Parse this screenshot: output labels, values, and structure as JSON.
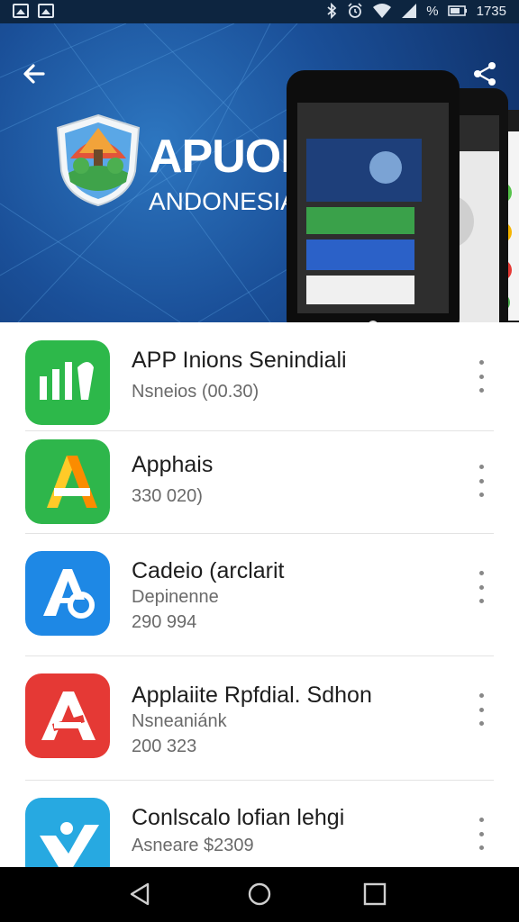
{
  "status_bar": {
    "left_icons": [
      "image-icon",
      "image-icon"
    ],
    "right_icons": [
      "bluetooth-icon",
      "alarm-icon",
      "wifi-icon",
      "signal-icon",
      "battery-icon"
    ],
    "battery_text": "%",
    "time": "1735"
  },
  "hero": {
    "back_icon": "arrow-left-icon",
    "share_icon": "share-icon",
    "brand_title": "APUOR",
    "brand_subtitle": "ANDONESIA",
    "accent": "#1a4f98"
  },
  "list": {
    "items": [
      {
        "title": "APP Inions Senindiali",
        "line1": "Nsneios (00.30)",
        "line2": "",
        "icon": "chart-app-icon",
        "color": "#2db84a"
      },
      {
        "title": "Apphais",
        "line1": "330 020)",
        "line2": "",
        "icon": "letter-a-app-icon",
        "color": "#2eb64b"
      },
      {
        "title": "Cadeio (arclarit",
        "line1": "Depinenne",
        "line2": "290 994",
        "icon": "letter-a-blue-app-icon",
        "color": "#1e88e5"
      },
      {
        "title": "Applaiite Rpfdial. Sdhon",
        "line1": "Nsneaniánk",
        "line2": "200 323",
        "icon": "letter-a-red-app-icon",
        "color": "#e53935"
      },
      {
        "title": "Conlscalo lofian lehgi",
        "line1": "Asneare $2309",
        "line2": "",
        "icon": "check-app-icon",
        "color": "#27a9e1"
      }
    ]
  },
  "nav_bar": {
    "back": "back-triangle-icon",
    "home": "home-circle-icon",
    "recents": "recents-square-icon"
  }
}
